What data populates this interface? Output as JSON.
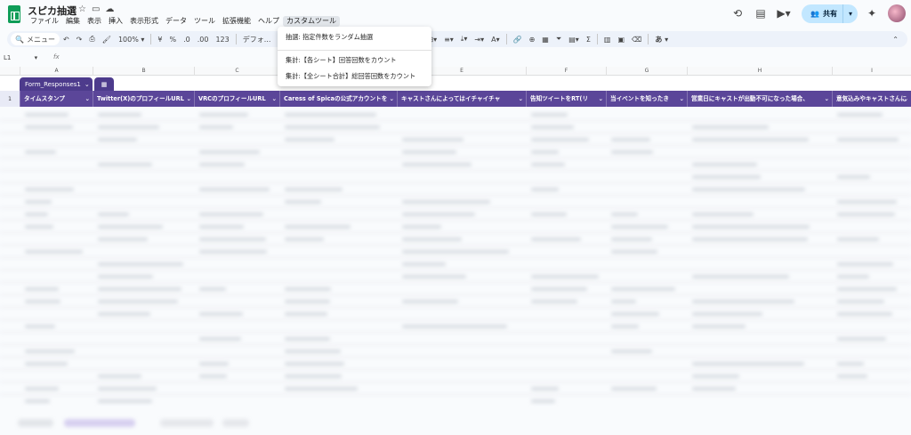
{
  "app": {
    "title": "スピカ抽選",
    "menus": [
      "ファイル",
      "編集",
      "表示",
      "挿入",
      "表示形式",
      "データ",
      "ツール",
      "拡張機能",
      "ヘルプ",
      "カスタムツール"
    ]
  },
  "header_right": {
    "share_label": "共有"
  },
  "toolbar": {
    "search_label": "メニュー",
    "zoom": "100%",
    "currency": "¥",
    "percent": "%",
    "dec_minus": ".0",
    "dec_plus": ".00",
    "number_format": "123",
    "font": "デフォ...",
    "input_mode": "あ"
  },
  "formula_bar": {
    "cell_ref": "L1",
    "fx_label": "fx"
  },
  "columns": [
    "A",
    "B",
    "C",
    "D",
    "E",
    "F",
    "G",
    "H",
    "I"
  ],
  "sheet_tab": {
    "label": "Form_Responses1"
  },
  "header_row": {
    "row_number": "1",
    "cells": [
      "タイムスタンプ",
      "Twitter(X)のプロフィールURL",
      "VRCのプロフィールURL",
      "Caress of Spicaの公式アカウントを",
      "キャストさんによってはイチャイチャ",
      "告知ツイートをRT(リ",
      "当イベントを知ったき",
      "営業日にキャストが出動不可になった場合、",
      "意気込みやキャストさんに"
    ]
  },
  "dropdown": {
    "items": [
      "抽選: 指定件数をランダム抽選",
      "集計:【各シート】回答回数をカウント",
      "集計:【全シート合計】総回答回数をカウント"
    ]
  },
  "colors": {
    "accent": "#5b4699",
    "share_bg": "#c2e7ff",
    "logo": "#0f9d58"
  }
}
